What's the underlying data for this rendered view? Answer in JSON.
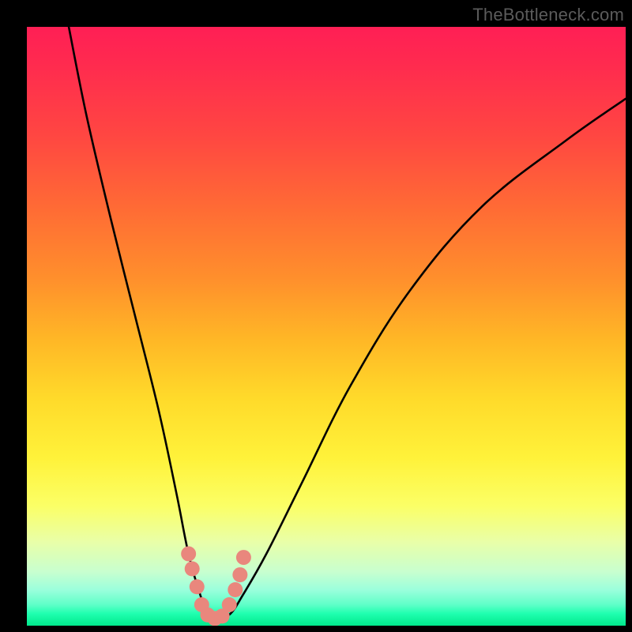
{
  "watermark": "TheBottleneck.com",
  "chart_data": {
    "type": "line",
    "title": "",
    "xlabel": "",
    "ylabel": "",
    "xlim": [
      0,
      100
    ],
    "ylim": [
      0,
      100
    ],
    "grid": false,
    "legend": false,
    "background": {
      "type": "vertical-gradient",
      "stops": [
        {
          "pos": 0,
          "color": "#ff1f55"
        },
        {
          "pos": 50,
          "color": "#ffb626"
        },
        {
          "pos": 75,
          "color": "#fff23a"
        },
        {
          "pos": 100,
          "color": "#00e88c"
        }
      ]
    },
    "series": [
      {
        "name": "bottleneck-curve",
        "color": "#000000",
        "x": [
          7,
          10,
          14,
          18,
          22,
          25,
          27,
          29,
          30.5,
          32,
          34,
          36,
          40,
          46,
          54,
          64,
          76,
          90,
          100
        ],
        "y": [
          100,
          85,
          68,
          52,
          36,
          22,
          12,
          5,
          1.5,
          1,
          2,
          5,
          12,
          24,
          40,
          56,
          70,
          81,
          88
        ]
      }
    ],
    "markers": [
      {
        "name": "marker-dots",
        "color": "#e9877d",
        "points": [
          {
            "x": 27.0,
            "y": 12.0
          },
          {
            "x": 27.6,
            "y": 9.5
          },
          {
            "x": 28.4,
            "y": 6.5
          },
          {
            "x": 29.2,
            "y": 3.5
          },
          {
            "x": 30.2,
            "y": 1.8
          },
          {
            "x": 31.4,
            "y": 1.2
          },
          {
            "x": 32.6,
            "y": 1.6
          },
          {
            "x": 33.8,
            "y": 3.5
          },
          {
            "x": 34.8,
            "y": 6.0
          },
          {
            "x": 35.6,
            "y": 8.5
          },
          {
            "x": 36.2,
            "y": 11.4
          }
        ]
      }
    ]
  }
}
